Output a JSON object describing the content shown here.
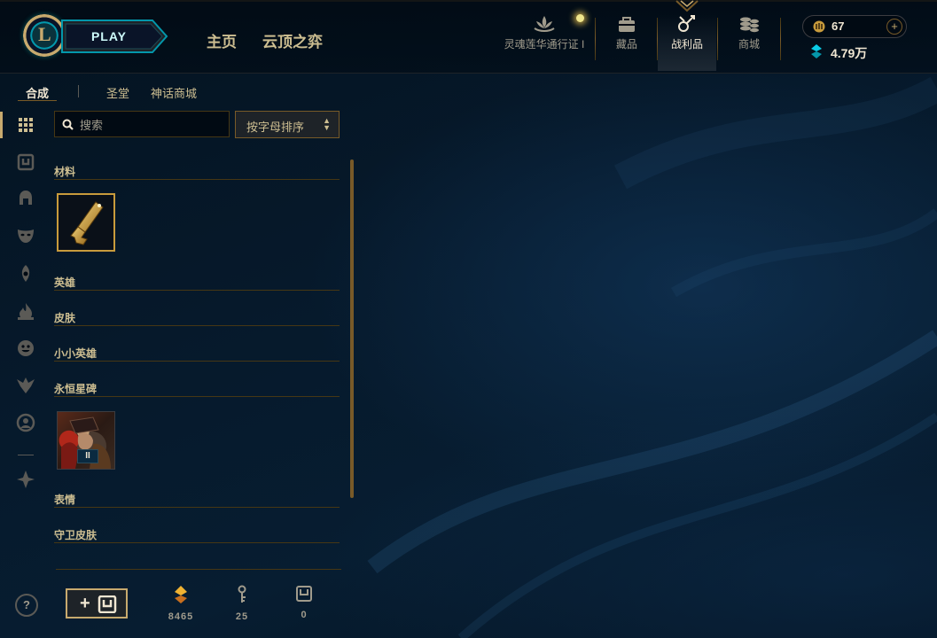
{
  "app": {
    "logo_letter": "L"
  },
  "topnav": {
    "play_label": "PLAY",
    "links": {
      "home": "主页",
      "tft": "云顶之弈"
    },
    "items": {
      "pass": "灵魂莲华通行证 I",
      "collection": "藏品",
      "loot": "战利品",
      "store": "商城"
    },
    "active_item": "loot",
    "icons": {
      "pass": "lotus-icon",
      "collection": "bag-icon",
      "loot": "loot-icon",
      "store": "coins-icon"
    }
  },
  "currency": {
    "rp": "67",
    "rp_add": "+",
    "blue_essence": "4.79万"
  },
  "subtabs": {
    "craft": "合成",
    "sanctum": "圣堂",
    "mythic_shop": "神话商城",
    "active": "craft"
  },
  "rail": {
    "items": [
      "grid-icon",
      "chest-icon",
      "helmet-icon",
      "mask-icon",
      "ward-icon",
      "flame-icon",
      "emote-face-icon",
      "icon-badge-icon",
      "summoner-icon",
      "eternals-icon"
    ],
    "active": "grid-icon"
  },
  "filters": {
    "search_placeholder": "搜索",
    "sort_label": "按字母排序"
  },
  "categories": [
    {
      "name": "材料",
      "tile": "hextech-key-fragment"
    },
    {
      "name": "英雄"
    },
    {
      "name": "皮肤"
    },
    {
      "name": "小小英雄"
    },
    {
      "name": "永恒星碑",
      "tile": "eternals-series-2",
      "tile_badge": "II"
    },
    {
      "name": "表情"
    },
    {
      "name": "守卫皮肤"
    }
  ],
  "bottom": {
    "add_chest": "+",
    "orange_essence": "8465",
    "keys": "25",
    "chests": "0"
  },
  "help": "?",
  "colors": {
    "gold": "#c8aa6e",
    "dark_gold": "#785a28",
    "orange_essence": "#f0b232",
    "blue_essence": "#0acbe6",
    "text": "#a09b8c"
  }
}
